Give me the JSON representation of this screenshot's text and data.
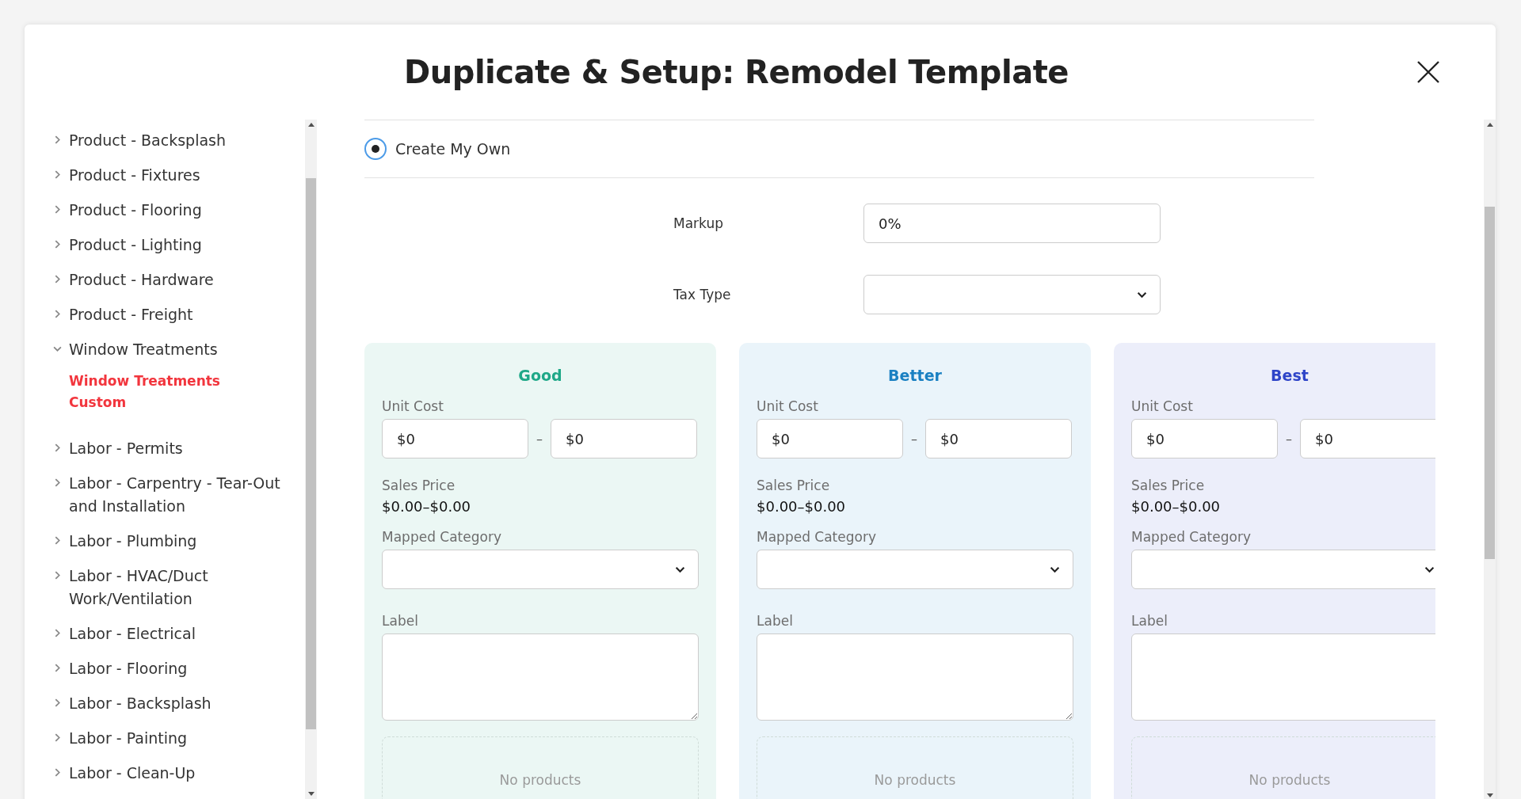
{
  "dialog": {
    "title": "Duplicate & Setup: Remodel Template"
  },
  "sidebar": {
    "items": [
      {
        "label": "Product - Backsplash",
        "expanded": false
      },
      {
        "label": "Product - Fixtures",
        "expanded": false
      },
      {
        "label": "Product - Flooring",
        "expanded": false
      },
      {
        "label": "Product - Lighting",
        "expanded": false
      },
      {
        "label": "Product - Hardware",
        "expanded": false
      },
      {
        "label": "Product - Freight",
        "expanded": false
      },
      {
        "label": "Window Treatments",
        "expanded": true,
        "children": [
          {
            "label": "Window Treatments Custom",
            "selected": true
          }
        ]
      },
      {
        "label": "Labor - Permits",
        "expanded": false
      },
      {
        "label": "Labor - Carpentry - Tear-Out and Installation",
        "expanded": false
      },
      {
        "label": "Labor - Plumbing",
        "expanded": false
      },
      {
        "label": "Labor - HVAC/Duct Work/Ventilation",
        "expanded": false
      },
      {
        "label": "Labor - Electrical",
        "expanded": false
      },
      {
        "label": "Labor - Flooring",
        "expanded": false
      },
      {
        "label": "Labor - Backsplash",
        "expanded": false
      },
      {
        "label": "Labor - Painting",
        "expanded": false
      },
      {
        "label": "Labor - Clean-Up",
        "expanded": false
      }
    ]
  },
  "option": {
    "label": "Create My Own",
    "selected": true
  },
  "markup": {
    "label": "Markup",
    "value": "0%"
  },
  "tax_type": {
    "label": "Tax Type"
  },
  "tiers": [
    {
      "name": "Good",
      "color": "#1fa888",
      "unit_cost_label": "Unit Cost",
      "unit_cost_min": "$0",
      "separator": "–",
      "unit_cost_max": "$0",
      "sales_price_label": "Sales Price",
      "sales_price": "$0.00–$0.00",
      "mapped_category_label": "Mapped Category",
      "label_label": "Label",
      "products_empty": "No products"
    },
    {
      "name": "Better",
      "color": "#1a80c2",
      "unit_cost_label": "Unit Cost",
      "unit_cost_min": "$0",
      "separator": "–",
      "unit_cost_max": "$0",
      "sales_price_label": "Sales Price",
      "sales_price": "$0.00–$0.00",
      "mapped_category_label": "Mapped Category",
      "label_label": "Label",
      "products_empty": "No products"
    },
    {
      "name": "Best",
      "color": "#2e44c8",
      "unit_cost_label": "Unit Cost",
      "unit_cost_min": "$0",
      "separator": "–",
      "unit_cost_max": "$0",
      "sales_price_label": "Sales Price",
      "sales_price": "$0.00–$0.00",
      "mapped_category_label": "Mapped Category",
      "label_label": "Label",
      "products_empty": "No products"
    }
  ]
}
